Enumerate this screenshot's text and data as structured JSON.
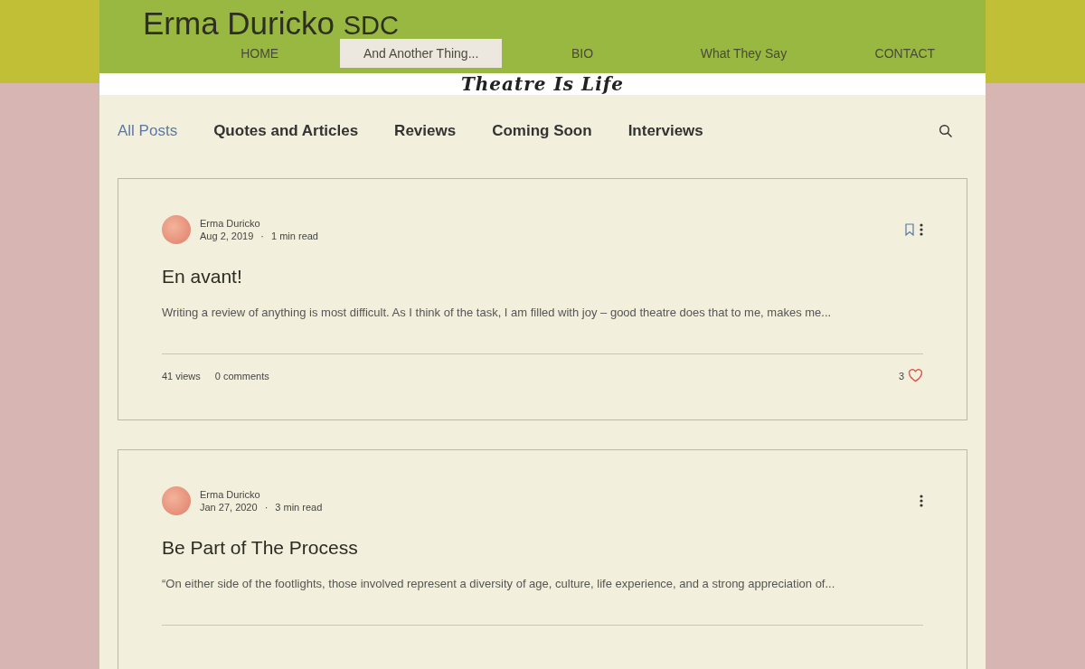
{
  "site": {
    "name": "Erma Duricko",
    "suffix": "SDC"
  },
  "nav": [
    {
      "label": "HOME",
      "selected": false
    },
    {
      "label": "And Another Thing...",
      "selected": true
    },
    {
      "label": "BIO",
      "selected": false
    },
    {
      "label": "What They Say",
      "selected": false
    },
    {
      "label": "CONTACT",
      "selected": false
    }
  ],
  "tagline": "Theatre Is Life",
  "categories": [
    {
      "label": "All Posts",
      "selected": true
    },
    {
      "label": "Quotes and Articles",
      "selected": false
    },
    {
      "label": "Reviews",
      "selected": false
    },
    {
      "label": "Coming Soon",
      "selected": false
    },
    {
      "label": "Interviews",
      "selected": false
    }
  ],
  "posts": [
    {
      "author": "Erma Duricko",
      "date": "Aug 2, 2019",
      "separator": "·",
      "read_time": "1 min read",
      "bookmark_visible": true,
      "title": "En avant!",
      "excerpt": "Writing a review of anything is most difficult. As I think of the task, I am filled with joy – good theatre does that to me, makes me...",
      "views": "41 views",
      "comments": "0 comments",
      "likes": "3"
    },
    {
      "author": "Erma Duricko",
      "date": "Jan 27, 2020",
      "separator": "·",
      "read_time": "3 min read",
      "bookmark_visible": false,
      "title": "Be Part of The Process",
      "excerpt": "“On either side of the footlights, those involved represent a diversity of age, culture, life experience, and a strong appreciation of..."
    }
  ]
}
